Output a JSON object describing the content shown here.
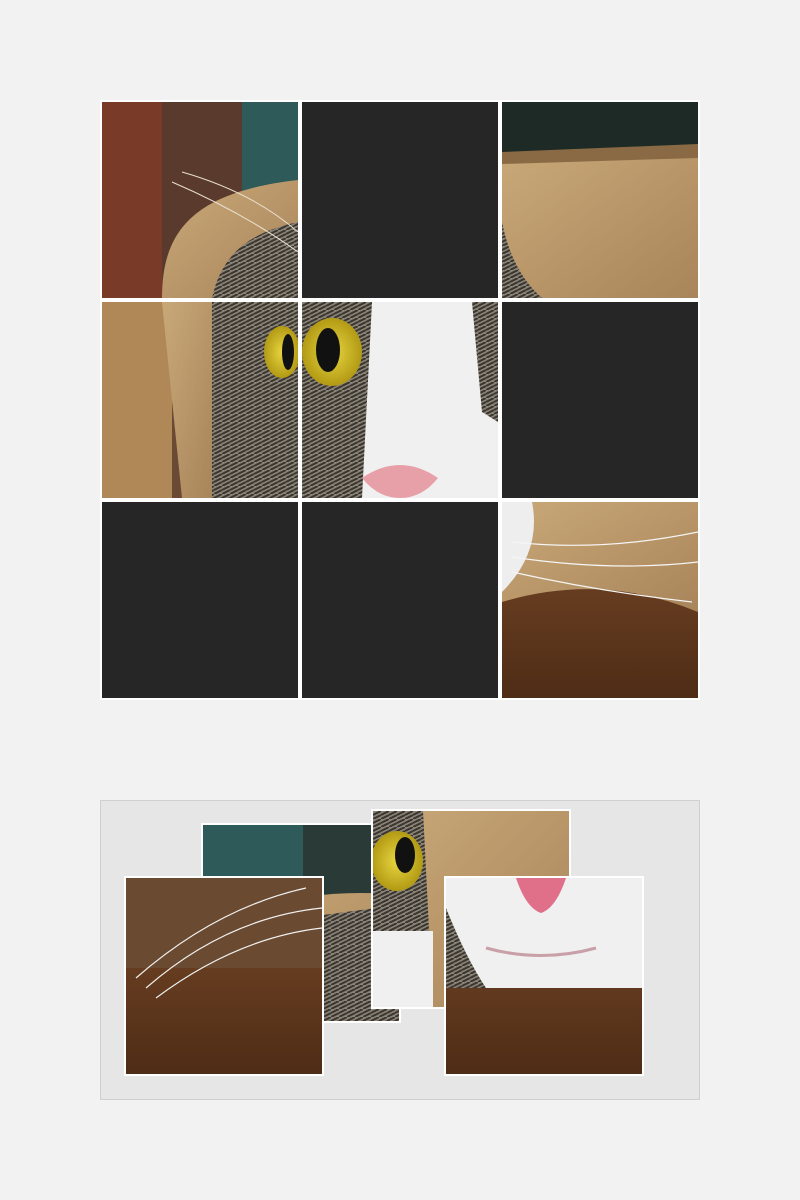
{
  "game": {
    "type": "image-jigsaw-3x3",
    "board": {
      "rows": 3,
      "cols": 3,
      "cells": [
        {
          "row": 0,
          "col": 0,
          "state": "filled",
          "piece": "top-left"
        },
        {
          "row": 0,
          "col": 1,
          "state": "empty"
        },
        {
          "row": 0,
          "col": 2,
          "state": "filled",
          "piece": "top-right"
        },
        {
          "row": 1,
          "col": 0,
          "state": "filled",
          "piece": "middle-left"
        },
        {
          "row": 1,
          "col": 1,
          "state": "filled",
          "piece": "center"
        },
        {
          "row": 1,
          "col": 2,
          "state": "empty"
        },
        {
          "row": 2,
          "col": 0,
          "state": "empty"
        },
        {
          "row": 2,
          "col": 1,
          "state": "empty"
        },
        {
          "row": 2,
          "col": 2,
          "state": "filled",
          "piece": "bottom-right"
        }
      ],
      "filled_count": 5,
      "empty_count": 4
    },
    "tray": {
      "pieces_remaining": 4,
      "pieces": [
        "top-center",
        "middle-right",
        "bottom-left",
        "bottom-center"
      ]
    },
    "colors": {
      "background": "#f2f2f2",
      "empty_slot": "#262626",
      "tray": "#e6e6e6",
      "grid_line": "#ffffff"
    }
  }
}
